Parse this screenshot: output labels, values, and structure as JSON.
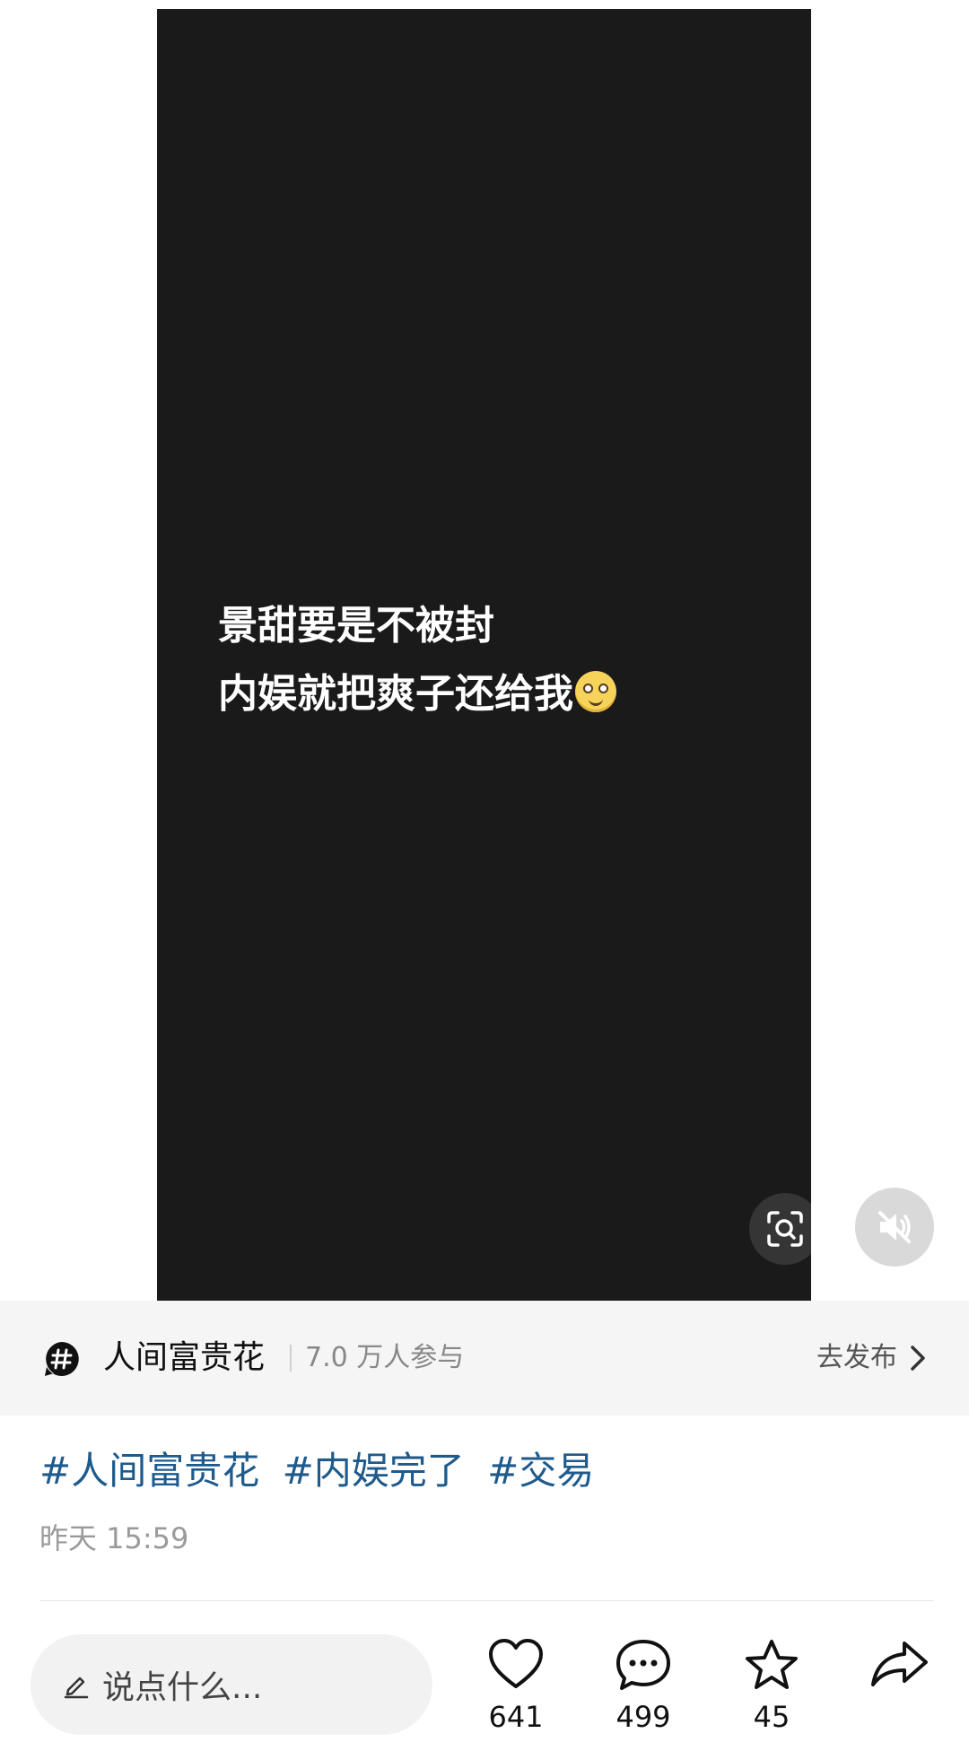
{
  "video": {
    "caption_line1": "景甜要是不被封",
    "caption_line2": "内娱就把爽子还给我",
    "emoji": "flushed-face"
  },
  "topic": {
    "name": "人间富贵花",
    "participants": "7.0 万人参与",
    "action_label": "去发布"
  },
  "post": {
    "hashtags": [
      "#人间富贵花",
      "#内娱完了",
      "#交易"
    ],
    "time": "昨天 15:59"
  },
  "bottom_bar": {
    "comment_placeholder": "说点什么...",
    "likes": "641",
    "comments": "499",
    "favorites": "45"
  }
}
